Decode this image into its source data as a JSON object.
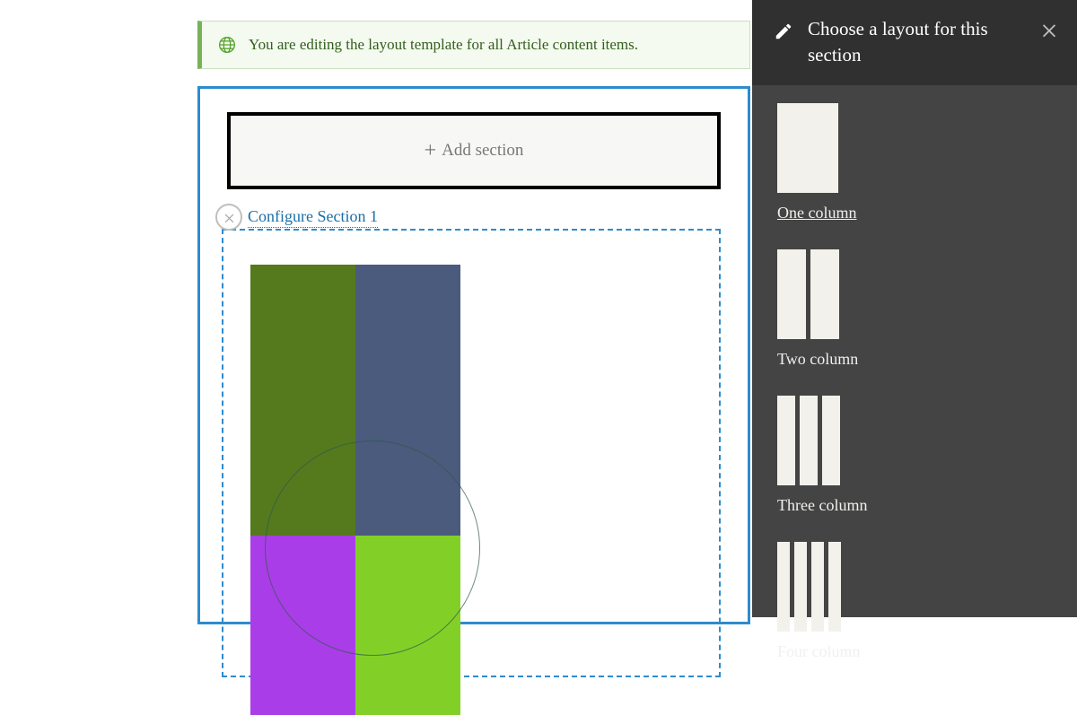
{
  "status": {
    "message": "You are editing the layout template for all Article content items."
  },
  "canvas": {
    "add_section_label": "Add section",
    "section_configure_label": "Configure Section 1"
  },
  "sidebar": {
    "title": "Choose a layout for this section",
    "options": [
      {
        "label": "One column"
      },
      {
        "label": "Two column"
      },
      {
        "label": "Three column"
      },
      {
        "label": "Four column"
      }
    ]
  }
}
